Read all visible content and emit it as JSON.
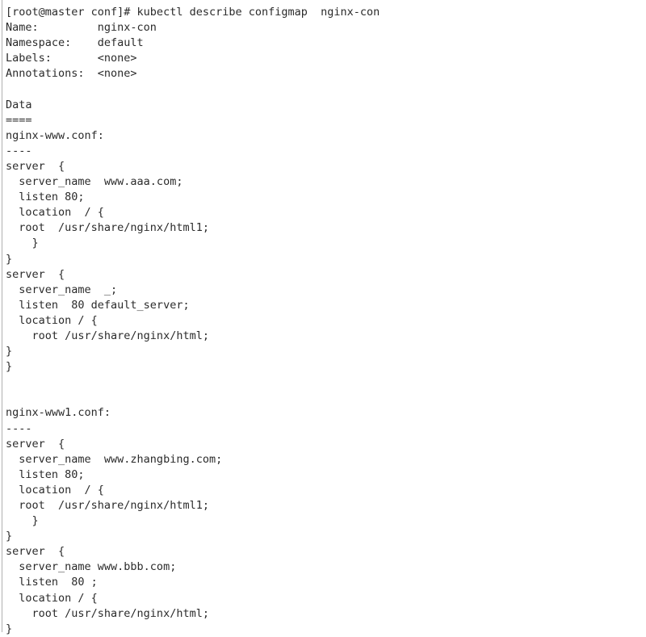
{
  "terminal": {
    "type": "terminal-scrollback",
    "background_color": "#ffffff",
    "text_color": "#2b2b2b",
    "font": "monospace",
    "prompt": "[root@master conf]#",
    "command": "kubectl describe configmap  nginx-con",
    "clipped_top_line": "",
    "lines": [
      "",
      "[root@master conf]# kubectl describe configmap  nginx-con",
      "Name:         nginx-con",
      "Namespace:    default",
      "Labels:       <none>",
      "Annotations:  <none>",
      "",
      "Data",
      "====",
      "nginx-www.conf:",
      "----",
      "server  {",
      "  server_name  www.aaa.com;",
      "  listen 80;",
      "  location  / {",
      "  root  /usr/share/nginx/html1;",
      "    }",
      "}",
      "server  {",
      "  server_name  _;",
      "  listen  80 default_server;",
      "  location / {",
      "    root /usr/share/nginx/html;",
      "}",
      "}",
      "",
      "",
      "nginx-www1.conf:",
      "----",
      "server  {",
      "  server_name  www.zhangbing.com;",
      "  listen 80;",
      "  location  / {",
      "  root  /usr/share/nginx/html1;",
      "    }",
      "}",
      "server  {",
      "  server_name www.bbb.com;",
      "  listen  80 ;",
      "  location / {",
      "    root /usr/share/nginx/html;",
      "}"
    ],
    "describe_output": {
      "Name": "nginx-con",
      "Namespace": "default",
      "Labels": "<none>",
      "Annotations": "<none>",
      "data_header": "Data",
      "data_underline": "====",
      "keys": [
        {
          "key": "nginx-www.conf:",
          "underline": "----",
          "value": "server  {\n  server_name  www.aaa.com;\n  listen 80;\n  location  / {\n  root  /usr/share/nginx/html1;\n    }\n}\nserver  {\n  server_name  _;\n  listen  80 default_server;\n  location / {\n    root /usr/share/nginx/html;\n}\n}"
        },
        {
          "key": "nginx-www1.conf:",
          "underline": "----",
          "value": "server  {\n  server_name  www.zhangbing.com;\n  listen 80;\n  location  / {\n  root  /usr/share/nginx/html1;\n    }\n}\nserver  {\n  server_name www.bbb.com;\n  listen  80 ;\n  location / {\n    root /usr/share/nginx/html;\n}"
        }
      ]
    }
  }
}
